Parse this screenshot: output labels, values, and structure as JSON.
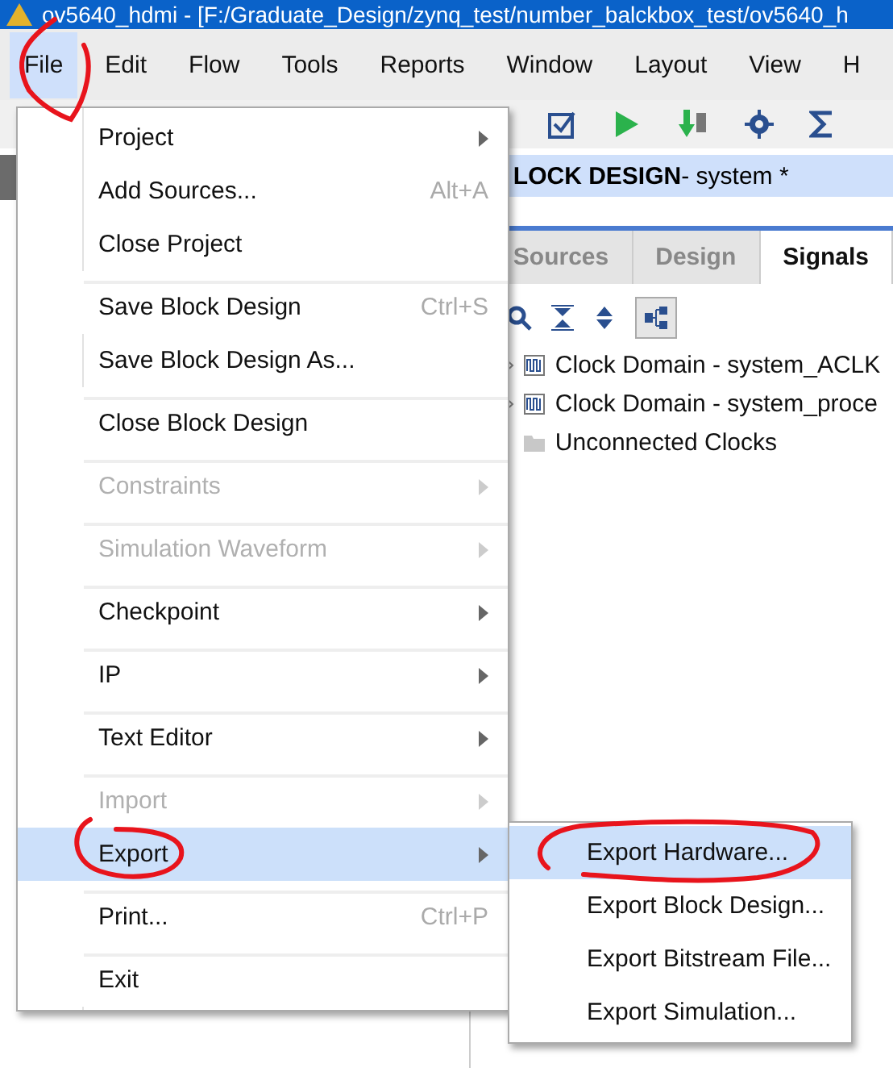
{
  "window": {
    "title": "ov5640_hdmi - [F:/Graduate_Design/zynq_test/number_balckbox_test/ov5640_h"
  },
  "menubar": [
    {
      "label": "File",
      "selected": true
    },
    {
      "label": "Edit",
      "selected": false
    },
    {
      "label": "Flow",
      "selected": false
    },
    {
      "label": "Tools",
      "selected": false
    },
    {
      "label": "Reports",
      "selected": false
    },
    {
      "label": "Window",
      "selected": false
    },
    {
      "label": "Layout",
      "selected": false
    },
    {
      "label": "View",
      "selected": false
    },
    {
      "label": "H",
      "selected": false
    }
  ],
  "panel": {
    "title": "LOCK DESIGN",
    "subtitle": " - system *"
  },
  "tabs": [
    {
      "label": "Sources",
      "selected": false
    },
    {
      "label": "Design",
      "selected": false
    },
    {
      "label": "Signals",
      "selected": true
    }
  ],
  "tree": [
    {
      "label": "Clock Domain - system_ACLK",
      "kind": "domain"
    },
    {
      "label": "Clock Domain - system_proce",
      "kind": "domain"
    },
    {
      "label": "Unconnected Clocks",
      "kind": "folder"
    }
  ],
  "file_menu": [
    {
      "label": "Project",
      "submenu": true,
      "disabled": false,
      "selected": false,
      "group_start": false
    },
    {
      "label": "Add Sources...",
      "shortcut": "Alt+A",
      "submenu": false,
      "disabled": false,
      "selected": false,
      "group_start": false
    },
    {
      "label": "Close Project",
      "submenu": false,
      "disabled": false,
      "selected": false,
      "group_start": false
    },
    {
      "label": "Save Block Design",
      "shortcut": "Ctrl+S",
      "submenu": false,
      "disabled": false,
      "selected": false,
      "group_start": true
    },
    {
      "label": "Save Block Design As...",
      "submenu": false,
      "disabled": false,
      "selected": false,
      "group_start": false
    },
    {
      "label": "Close Block Design",
      "submenu": false,
      "disabled": false,
      "selected": false,
      "group_start": true
    },
    {
      "label": "Constraints",
      "submenu": true,
      "disabled": true,
      "selected": false,
      "group_start": true
    },
    {
      "label": "Simulation Waveform",
      "submenu": true,
      "disabled": true,
      "selected": false,
      "group_start": true
    },
    {
      "label": "Checkpoint",
      "submenu": true,
      "disabled": false,
      "selected": false,
      "group_start": true
    },
    {
      "label": "IP",
      "submenu": true,
      "disabled": false,
      "selected": false,
      "group_start": true
    },
    {
      "label": "Text Editor",
      "submenu": true,
      "disabled": false,
      "selected": false,
      "group_start": true
    },
    {
      "label": "Import",
      "submenu": true,
      "disabled": true,
      "selected": false,
      "group_start": true
    },
    {
      "label": "Export",
      "submenu": true,
      "disabled": false,
      "selected": true,
      "group_start": false
    },
    {
      "label": "Print...",
      "shortcut": "Ctrl+P",
      "submenu": false,
      "disabled": false,
      "selected": false,
      "group_start": true
    },
    {
      "label": "Exit",
      "submenu": false,
      "disabled": false,
      "selected": false,
      "group_start": true
    }
  ],
  "export_menu": [
    {
      "label": "Export Hardware...",
      "selected": true
    },
    {
      "label": "Export Block Design...",
      "selected": false
    },
    {
      "label": "Export Bitstream File...",
      "selected": false
    },
    {
      "label": "Export Simulation...",
      "selected": false
    }
  ]
}
